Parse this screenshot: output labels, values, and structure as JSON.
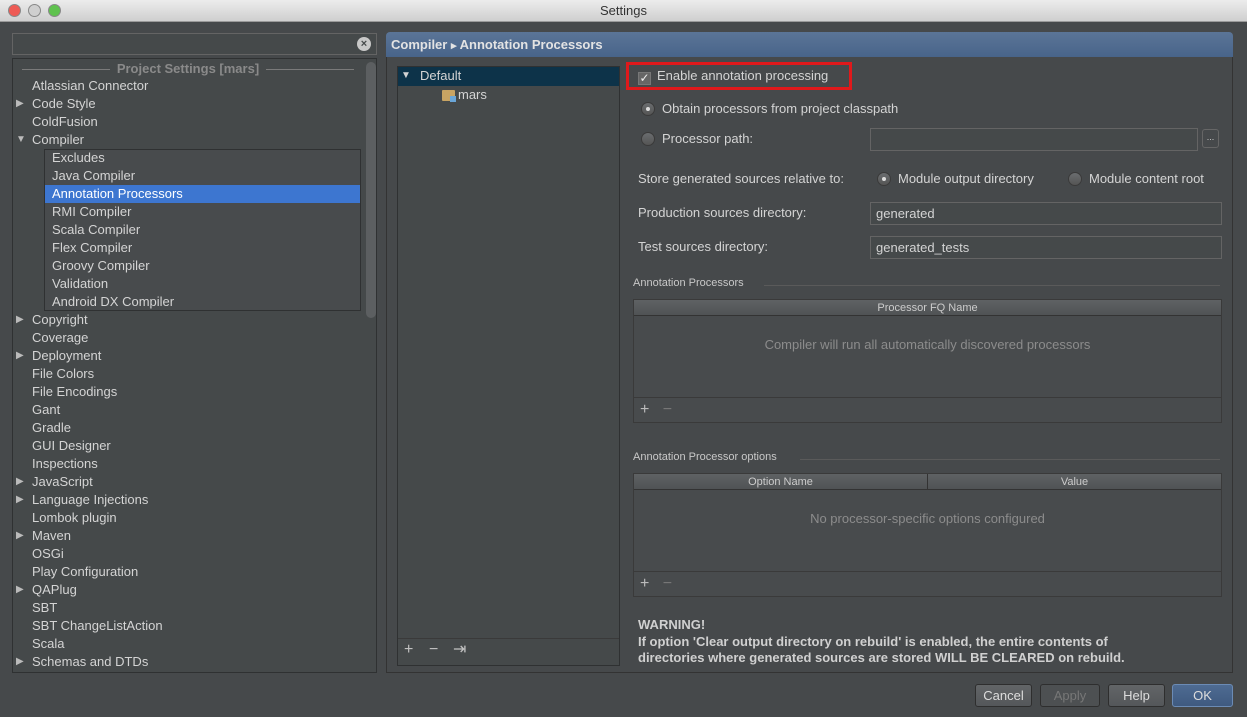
{
  "window": {
    "title": "Settings"
  },
  "search": {
    "value": "",
    "placeholder": ""
  },
  "sidebar": {
    "section": "Project Settings [mars]",
    "items": [
      {
        "label": "Atlassian Connector",
        "level": 0,
        "arrow": ""
      },
      {
        "label": "Code Style",
        "level": 0,
        "arrow": "▶"
      },
      {
        "label": "ColdFusion",
        "level": 0,
        "arrow": ""
      },
      {
        "label": "Compiler",
        "level": 0,
        "arrow": "▼"
      },
      {
        "label": "Excludes",
        "level": 1,
        "arrow": ""
      },
      {
        "label": "Java Compiler",
        "level": 1,
        "arrow": ""
      },
      {
        "label": "Annotation Processors",
        "level": 1,
        "arrow": "",
        "selected": true
      },
      {
        "label": "RMI Compiler",
        "level": 1,
        "arrow": ""
      },
      {
        "label": "Scala Compiler",
        "level": 1,
        "arrow": ""
      },
      {
        "label": "Flex Compiler",
        "level": 1,
        "arrow": ""
      },
      {
        "label": "Groovy Compiler",
        "level": 1,
        "arrow": ""
      },
      {
        "label": "Validation",
        "level": 1,
        "arrow": ""
      },
      {
        "label": "Android DX Compiler",
        "level": 1,
        "arrow": ""
      },
      {
        "label": "Copyright",
        "level": 0,
        "arrow": "▶"
      },
      {
        "label": "Coverage",
        "level": 0,
        "arrow": ""
      },
      {
        "label": "Deployment",
        "level": 0,
        "arrow": "▶"
      },
      {
        "label": "File Colors",
        "level": 0,
        "arrow": ""
      },
      {
        "label": "File Encodings",
        "level": 0,
        "arrow": ""
      },
      {
        "label": "Gant",
        "level": 0,
        "arrow": ""
      },
      {
        "label": "Gradle",
        "level": 0,
        "arrow": ""
      },
      {
        "label": "GUI Designer",
        "level": 0,
        "arrow": ""
      },
      {
        "label": "Inspections",
        "level": 0,
        "arrow": ""
      },
      {
        "label": "JavaScript",
        "level": 0,
        "arrow": "▶"
      },
      {
        "label": "Language Injections",
        "level": 0,
        "arrow": "▶"
      },
      {
        "label": "Lombok plugin",
        "level": 0,
        "arrow": ""
      },
      {
        "label": "Maven",
        "level": 0,
        "arrow": "▶"
      },
      {
        "label": "OSGi",
        "level": 0,
        "arrow": ""
      },
      {
        "label": "Play Configuration",
        "level": 0,
        "arrow": ""
      },
      {
        "label": "QAPlug",
        "level": 0,
        "arrow": "▶"
      },
      {
        "label": "SBT",
        "level": 0,
        "arrow": ""
      },
      {
        "label": "SBT ChangeListAction",
        "level": 0,
        "arrow": ""
      },
      {
        "label": "Scala",
        "level": 0,
        "arrow": ""
      },
      {
        "label": "Schemas and DTDs",
        "level": 0,
        "arrow": "▶"
      }
    ]
  },
  "breadcrumb": {
    "parent": "Compiler",
    "sep": "▸",
    "current": "Annotation Processors"
  },
  "profiles": {
    "default": "Default",
    "module": "mars",
    "add": "+",
    "remove": "−",
    "move": "⇥"
  },
  "form": {
    "enable_label": "Enable annotation processing",
    "enable_checked": true,
    "obtain_label": "Obtain processors from project classpath",
    "obtain_selected": true,
    "path_label": "Processor path:",
    "path_value": "",
    "browse": "...",
    "store_label": "Store generated sources relative to:",
    "store_opt1": "Module output directory",
    "store_opt2": "Module content root",
    "store_selected": "Module output directory",
    "prod_label": "Production sources directory:",
    "prod_value": "generated",
    "test_label": "Test sources directory:",
    "test_value": "generated_tests"
  },
  "processors": {
    "title": "Annotation Processors",
    "column": "Processor FQ Name",
    "empty": "Compiler will run all automatically discovered processors",
    "add": "+",
    "remove": "−"
  },
  "options": {
    "title": "Annotation Processor options",
    "columns": [
      "Option Name",
      "Value"
    ],
    "empty": "No processor-specific options configured",
    "add": "+",
    "remove": "−"
  },
  "warning": {
    "title": "WARNING!",
    "line1": "If option 'Clear output directory on rebuild' is enabled, the entire contents of",
    "line2": "directories where generated sources are stored WILL BE CLEARED on rebuild."
  },
  "buttons": {
    "cancel": "Cancel",
    "apply": "Apply",
    "help": "Help",
    "ok": "OK"
  }
}
